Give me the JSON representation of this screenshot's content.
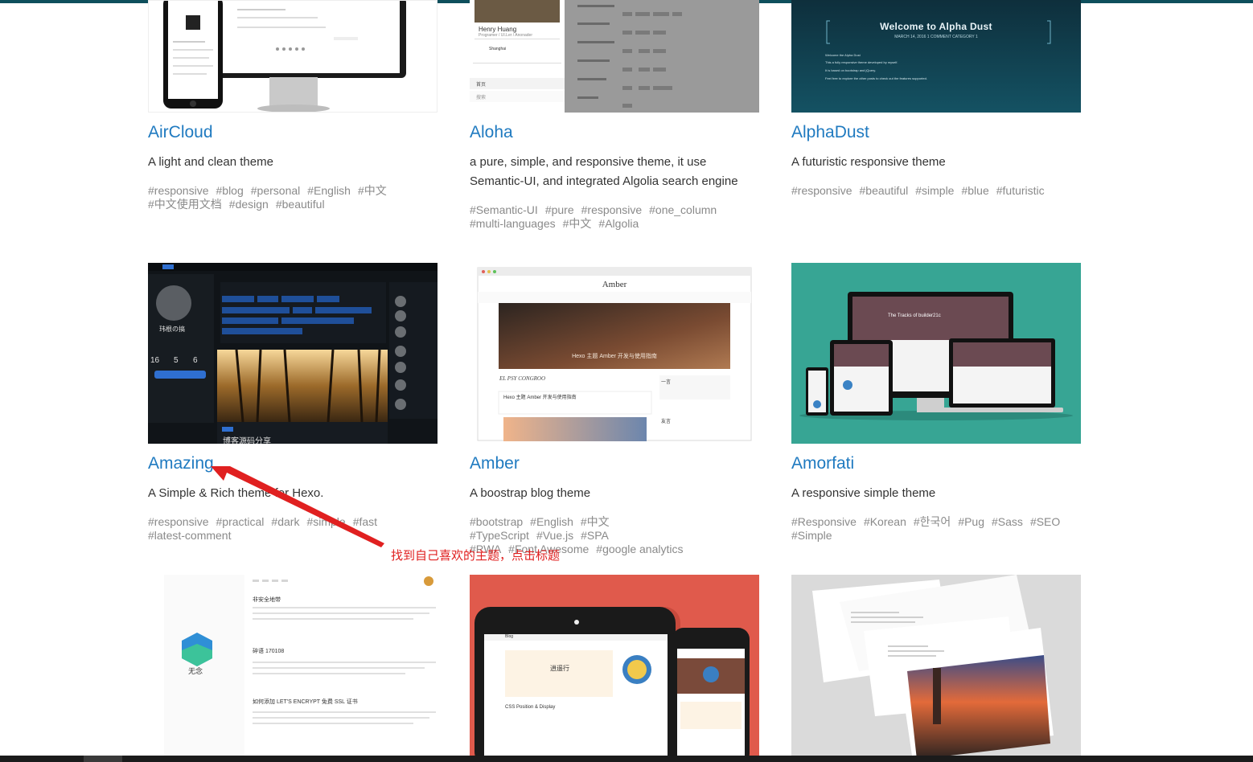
{
  "themes": [
    {
      "title": "AirCloud",
      "desc": "A light and clean theme",
      "tags": [
        "#responsive",
        "#blog",
        "#personal",
        "#English",
        "#中文",
        "#中文使用文档",
        "#design",
        "#beautiful"
      ]
    },
    {
      "title": "Aloha",
      "desc": "a pure, simple, and responsive theme, it use Semantic-UI, and integrated Algolia search engine",
      "tags": [
        "#Semantic-UI",
        "#pure",
        "#responsive",
        "#one_column",
        "#multi-languages",
        "#中文",
        "#Algolia"
      ]
    },
    {
      "title": "AlphaDust",
      "desc": "A futuristic responsive theme",
      "tags": [
        "#responsive",
        "#beautiful",
        "#simple",
        "#blue",
        "#futuristic"
      ]
    },
    {
      "title": "Amazing",
      "desc": "A Simple & Rich theme for Hexo.",
      "tags": [
        "#responsive",
        "#practical",
        "#dark",
        "#simple",
        "#fast",
        "#latest-comment"
      ]
    },
    {
      "title": "Amber",
      "desc": "A boostrap blog theme",
      "tags": [
        "#bootstrap",
        "#English",
        "#中文",
        "#TypeScript",
        "#Vue.js",
        "#SPA",
        "#PWA",
        "#Font Awesome",
        "#google analytics"
      ]
    },
    {
      "title": "Amorfati",
      "desc": "A responsive simple theme",
      "tags": [
        "#Responsive",
        "#Korean",
        "#한국어",
        "#Pug",
        "#Sass",
        "#SEO",
        "#Simple"
      ]
    }
  ],
  "annotation": {
    "text": "找到自己喜欢的主题，点击标题",
    "color": "#e02020"
  },
  "thumbs": {
    "aloha_author": "Henry Huang",
    "aloha_role": "Programer / UI.Ler / Anonader",
    "aloha_city": "Shanghai",
    "aloha_menu": "首页",
    "aloha_search": "搜索",
    "alphadust_heading": "Welcome to Alpha Dust",
    "alphadust_meta": "MARCH 14, 2016   1 COMMENT   CATEGORY 1",
    "alphadust_lines": [
      "Welcome the Alpha Dust",
      "This a fully responsive theme developed by myself.",
      "It is based on bootstrap and jQuery.",
      "Feel free to explore the other posts to check out the features supported."
    ],
    "amber_logo": "Amber",
    "amber_slide": "Hexo 主题 Amber 开发与使用指南",
    "amber_motto": "EL PSY CONGROO",
    "amber_post": "Hexo 主题 Amber 开发与使用指南",
    "amber_side": "一言",
    "amber_friends": "友言",
    "amazing_name": "玮根の搞",
    "amazing_stats": [
      "16",
      "5",
      "6"
    ],
    "amazing_post": "博客源码分享",
    "amorfati_banner": "The Tracks of builder21c",
    "wunian_name": "无念",
    "wunian_post1": "非安全地带",
    "wunian_post2": "碎语 170108",
    "wunian_post3": "如何添加 LET'S ENCRYPT 免费 SSL 证书",
    "anisina_logo": "Blog",
    "anisina_post": "逍遥行",
    "anisina_post2": "CSS Position & Display"
  },
  "colors": {
    "title": "#1f7ac0",
    "tag": "#8a8a8a",
    "desc": "#333333",
    "topbar": "#0e4f5c"
  }
}
